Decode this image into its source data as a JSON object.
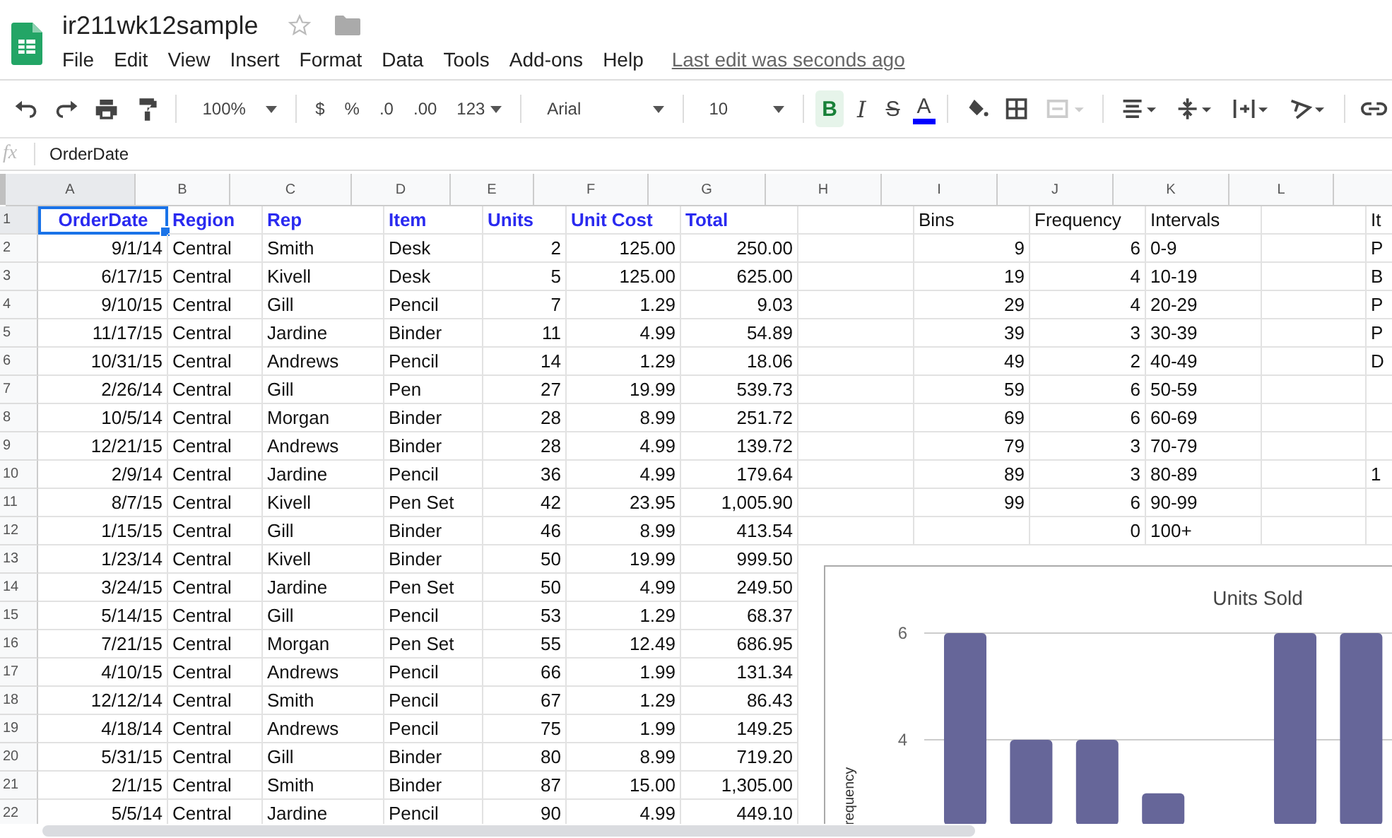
{
  "document": {
    "title": "ir211wk12sample",
    "last_edit": "Last edit was seconds ago"
  },
  "menu": [
    "File",
    "Edit",
    "View",
    "Insert",
    "Format",
    "Data",
    "Tools",
    "Add-ons",
    "Help"
  ],
  "toolbar": {
    "zoom": "100%",
    "currency": "$",
    "percent": "%",
    "decrease_decimals": ".0",
    "increase_decimals": ".00",
    "more_formats": "123",
    "font": "Arial",
    "font_size": "10",
    "bold": {
      "label": "B",
      "selected": true
    },
    "italic": {
      "label": "I",
      "selected": false
    },
    "strikethrough": {
      "label": "S",
      "selected": false
    },
    "text_color": {
      "label": "A",
      "color": "#0000ff"
    }
  },
  "formula_bar": {
    "icon": "fx",
    "value": "OrderDate"
  },
  "sheet": {
    "columns": [
      {
        "label": "A",
        "selected": true
      },
      {
        "label": "B",
        "selected": false
      },
      {
        "label": "C",
        "selected": false
      },
      {
        "label": "D",
        "selected": false
      },
      {
        "label": "E",
        "selected": false
      },
      {
        "label": "F",
        "selected": false
      },
      {
        "label": "G",
        "selected": false
      },
      {
        "label": "H",
        "selected": false
      },
      {
        "label": "I",
        "selected": false
      },
      {
        "label": "J",
        "selected": false
      },
      {
        "label": "K",
        "selected": false
      },
      {
        "label": "L",
        "selected": false
      }
    ],
    "rows": [
      {
        "number": "1",
        "kind": "header",
        "selected": true,
        "cells": {
          "A": "OrderDate",
          "B": "Region",
          "C": "Rep",
          "D": "Item",
          "E": "Units",
          "F": "Unit Cost",
          "G": "Total",
          "I": "Bins",
          "J": "Frequency",
          "K": "Intervals",
          "column_13": "It"
        }
      },
      {
        "number": "2",
        "selected": false,
        "cells": {
          "A": "9/1/14",
          "B": "Central",
          "C": "Smith",
          "D": "Desk",
          "E": "2",
          "F": "125.00",
          "G": "250.00",
          "I": "9",
          "J": "6",
          "K": "0-9",
          "column_13": "P"
        }
      },
      {
        "number": "3",
        "selected": false,
        "cells": {
          "A": "6/17/15",
          "B": "Central",
          "C": "Kivell",
          "D": "Desk",
          "E": "5",
          "F": "125.00",
          "G": "625.00",
          "I": "19",
          "J": "4",
          "K": "10-19",
          "column_13": "B"
        }
      },
      {
        "number": "4",
        "selected": false,
        "cells": {
          "A": "9/10/15",
          "B": "Central",
          "C": "Gill",
          "D": "Pencil",
          "E": "7",
          "F": "1.29",
          "G": "9.03",
          "I": "29",
          "J": "4",
          "K": "20-29",
          "column_13": "P"
        }
      },
      {
        "number": "5",
        "selected": false,
        "cells": {
          "A": "11/17/15",
          "B": "Central",
          "C": "Jardine",
          "D": "Binder",
          "E": "11",
          "F": "4.99",
          "G": "54.89",
          "I": "39",
          "J": "3",
          "K": "30-39",
          "column_13": "P"
        }
      },
      {
        "number": "6",
        "selected": false,
        "cells": {
          "A": "10/31/15",
          "B": "Central",
          "C": "Andrews",
          "D": "Pencil",
          "E": "14",
          "F": "1.29",
          "G": "18.06",
          "I": "49",
          "J": "2",
          "K": "40-49",
          "column_13": "D"
        }
      },
      {
        "number": "7",
        "selected": false,
        "cells": {
          "A": "2/26/14",
          "B": "Central",
          "C": "Gill",
          "D": "Pen",
          "E": "27",
          "F": "19.99",
          "G": "539.73",
          "I": "59",
          "J": "6",
          "K": "50-59"
        }
      },
      {
        "number": "8",
        "selected": false,
        "cells": {
          "A": "10/5/14",
          "B": "Central",
          "C": "Morgan",
          "D": "Binder",
          "E": "28",
          "F": "8.99",
          "G": "251.72",
          "I": "69",
          "J": "6",
          "K": "60-69"
        }
      },
      {
        "number": "9",
        "selected": false,
        "cells": {
          "A": "12/21/15",
          "B": "Central",
          "C": "Andrews",
          "D": "Binder",
          "E": "28",
          "F": "4.99",
          "G": "139.72",
          "I": "79",
          "J": "3",
          "K": "70-79"
        }
      },
      {
        "number": "10",
        "selected": false,
        "cells": {
          "A": "2/9/14",
          "B": "Central",
          "C": "Jardine",
          "D": "Pencil",
          "E": "36",
          "F": "4.99",
          "G": "179.64",
          "I": "89",
          "J": "3",
          "K": "80-89",
          "column_13": "1"
        }
      },
      {
        "number": "11",
        "selected": false,
        "cells": {
          "A": "8/7/15",
          "B": "Central",
          "C": "Kivell",
          "D": "Pen Set",
          "E": "42",
          "F": "23.95",
          "G": "1,005.90",
          "I": "99",
          "J": "6",
          "K": "90-99"
        }
      },
      {
        "number": "12",
        "selected": false,
        "cells": {
          "A": "1/15/15",
          "B": "Central",
          "C": "Gill",
          "D": "Binder",
          "E": "46",
          "F": "8.99",
          "G": "413.54",
          "J": "0",
          "K": "100+"
        }
      },
      {
        "number": "13",
        "selected": false,
        "cells": {
          "A": "1/23/14",
          "B": "Central",
          "C": "Kivell",
          "D": "Binder",
          "E": "50",
          "F": "19.99",
          "G": "999.50"
        }
      },
      {
        "number": "14",
        "selected": false,
        "cells": {
          "A": "3/24/15",
          "B": "Central",
          "C": "Jardine",
          "D": "Pen Set",
          "E": "50",
          "F": "4.99",
          "G": "249.50"
        }
      },
      {
        "number": "15",
        "selected": false,
        "cells": {
          "A": "5/14/15",
          "B": "Central",
          "C": "Gill",
          "D": "Pencil",
          "E": "53",
          "F": "1.29",
          "G": "68.37"
        }
      },
      {
        "number": "16",
        "selected": false,
        "cells": {
          "A": "7/21/15",
          "B": "Central",
          "C": "Morgan",
          "D": "Pen Set",
          "E": "55",
          "F": "12.49",
          "G": "686.95"
        }
      },
      {
        "number": "17",
        "selected": false,
        "cells": {
          "A": "4/10/15",
          "B": "Central",
          "C": "Andrews",
          "D": "Pencil",
          "E": "66",
          "F": "1.99",
          "G": "131.34"
        }
      },
      {
        "number": "18",
        "selected": false,
        "cells": {
          "A": "12/12/14",
          "B": "Central",
          "C": "Smith",
          "D": "Pencil",
          "E": "67",
          "F": "1.29",
          "G": "86.43"
        }
      },
      {
        "number": "19",
        "selected": false,
        "cells": {
          "A": "4/18/14",
          "B": "Central",
          "C": "Andrews",
          "D": "Pencil",
          "E": "75",
          "F": "1.99",
          "G": "149.25"
        }
      },
      {
        "number": "20",
        "selected": false,
        "cells": {
          "A": "5/31/15",
          "B": "Central",
          "C": "Gill",
          "D": "Binder",
          "E": "80",
          "F": "8.99",
          "G": "719.20"
        }
      },
      {
        "number": "21",
        "selected": false,
        "cells": {
          "A": "2/1/15",
          "B": "Central",
          "C": "Smith",
          "D": "Binder",
          "E": "87",
          "F": "15.00",
          "G": "1,305.00"
        }
      },
      {
        "number": "22",
        "selected": false,
        "cells": {
          "A": "5/5/14",
          "B": "Central",
          "C": "Jardine",
          "D": "Pencil",
          "E": "90",
          "F": "4.99",
          "G": "449.10"
        }
      }
    ]
  },
  "chart": {
    "chart_data": {
      "type": "bar",
      "title": "Units Sold",
      "ylabel": "requency",
      "series": [
        {
          "color": "#666699",
          "values": [
            6,
            4,
            4,
            3,
            null,
            6,
            6
          ]
        }
      ],
      "ylim": [
        2.4,
        6
      ],
      "yticks": [
        {
          "value": 4,
          "label": "4"
        },
        {
          "value": 6,
          "label": "6"
        }
      ]
    }
  }
}
